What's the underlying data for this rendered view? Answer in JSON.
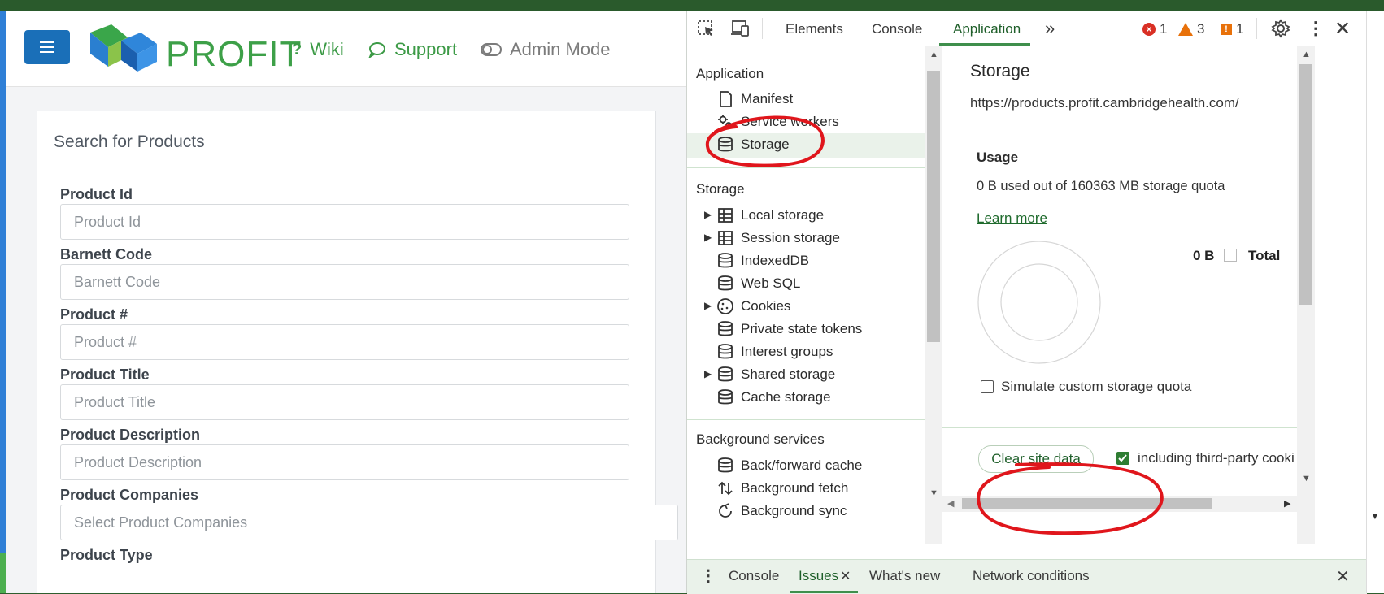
{
  "app": {
    "brand": "PROFIT",
    "nav": {
      "wiki": "Wiki",
      "support": "Support",
      "admin": "Admin Mode"
    },
    "card": {
      "title": "Search for Products",
      "fields": [
        {
          "label": "Product Id",
          "placeholder": "Product Id"
        },
        {
          "label": "Barnett Code",
          "placeholder": "Barnett Code"
        },
        {
          "label": "Product #",
          "placeholder": "Product #"
        },
        {
          "label": "Product Title",
          "placeholder": "Product Title"
        },
        {
          "label": "Product Description",
          "placeholder": "Product Description"
        },
        {
          "label": "Product Companies",
          "placeholder": "Select Product Companies"
        },
        {
          "label": "Product Type",
          "placeholder": ""
        }
      ]
    }
  },
  "devtools": {
    "tabs": [
      "Elements",
      "Console",
      "Application"
    ],
    "active_tab": "Application",
    "counts": {
      "errors": "1",
      "warnings": "3",
      "issues": "1"
    },
    "sidebar": {
      "application_heading": "Application",
      "application_items": [
        "Manifest",
        "Service workers",
        "Storage"
      ],
      "storage_heading": "Storage",
      "storage_items": [
        "Local storage",
        "Session storage",
        "IndexedDB",
        "Web SQL",
        "Cookies",
        "Private state tokens",
        "Interest groups",
        "Shared storage",
        "Cache storage"
      ],
      "background_heading": "Background services",
      "background_items": [
        "Back/forward cache",
        "Background fetch",
        "Background sync"
      ]
    },
    "pane": {
      "title": "Storage",
      "url": "https://products.profit.cambridgehealth.com/",
      "usage_heading": "Usage",
      "usage_text": "0 B used out of 160363 MB storage quota",
      "learn_more": "Learn more",
      "legend_value": "0 B",
      "legend_label": "Total",
      "simulate_label": "Simulate custom storage quota",
      "clear_button": "Clear site data",
      "including_label": "including third-party cooki",
      "including_checked": true
    },
    "drawer": {
      "tabs": [
        "Console",
        "Issues",
        "What's new",
        "Network conditions"
      ],
      "active": "Issues"
    }
  },
  "colors": {
    "brand_green": "#3da048",
    "menu_blue": "#1a6fb8",
    "annotation_red": "#e0161c"
  }
}
